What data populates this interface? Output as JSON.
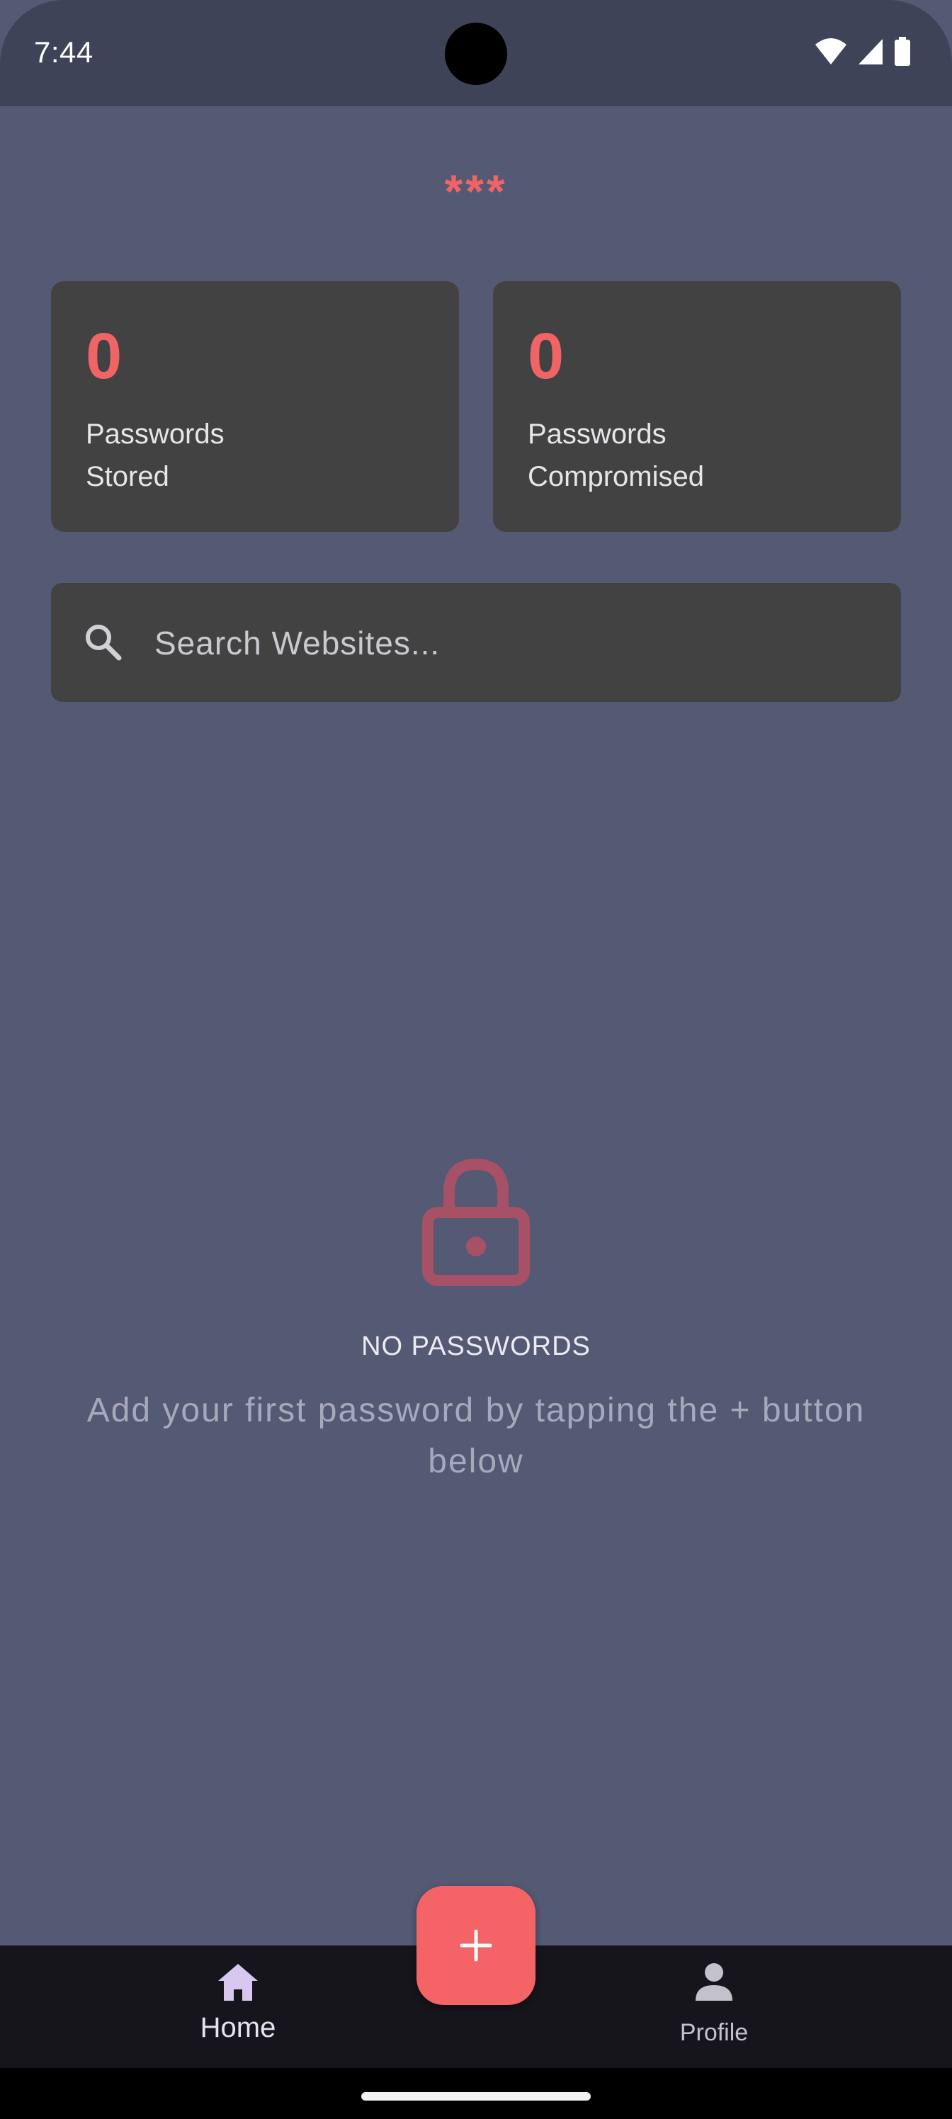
{
  "status_bar": {
    "time": "7:44",
    "icons": [
      "wifi-icon",
      "cell-signal-icon",
      "battery-icon"
    ]
  },
  "app": {
    "title": "***",
    "accent_color": "#f06466",
    "background_color": "#545974"
  },
  "stats": [
    {
      "value": "0",
      "label": "Passwords Stored"
    },
    {
      "value": "0",
      "label": "Passwords Compromised"
    }
  ],
  "search": {
    "placeholder": "Search Websites...",
    "value": "",
    "icon": "search-icon"
  },
  "empty_state": {
    "icon": "lock-icon",
    "title": "NO PASSWORDS",
    "subtitle": "Add your first password by tapping the + button below"
  },
  "fab": {
    "icon": "plus-icon"
  },
  "bottom_nav": {
    "items": [
      {
        "label": "Home",
        "icon": "home-icon",
        "selected": true
      },
      {
        "label": "Profile",
        "icon": "person-icon",
        "selected": false
      }
    ]
  }
}
